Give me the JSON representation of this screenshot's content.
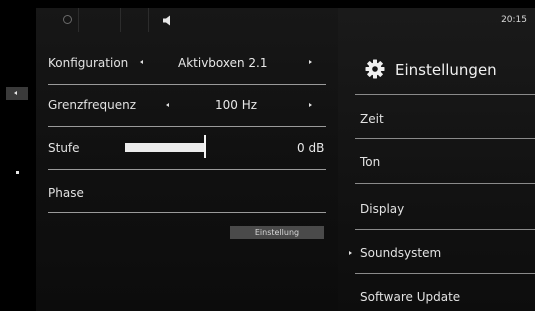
{
  "status_bar": {
    "time": "20:15"
  },
  "panel": {
    "title": "Einstellungen"
  },
  "menu": [
    {
      "label": "Zeit",
      "active": false
    },
    {
      "label": "Ton",
      "active": false
    },
    {
      "label": "Display",
      "active": false
    },
    {
      "label": "Soundsystem",
      "active": true
    },
    {
      "label": "Software Update",
      "active": false
    }
  ],
  "rows": {
    "konfiguration": {
      "label": "Konfiguration",
      "value": "Aktivboxen 2.1"
    },
    "grenzfrequenz": {
      "label": "Grenzfrequenz",
      "value": "100 Hz"
    },
    "stufe": {
      "label": "Stufe",
      "value": "0 dB",
      "level": 0.5
    },
    "phase": {
      "label": "Phase"
    }
  },
  "buttons": {
    "einstellung": "Einstellung"
  },
  "icons": {
    "status_left": "circle-icon",
    "status_right": "speaker-icon",
    "settings": "gear-icon",
    "side": "left-arrow-icon"
  },
  "colors": {
    "background": "#000000",
    "text": "#e2e2e2",
    "slider": "#ececec"
  }
}
